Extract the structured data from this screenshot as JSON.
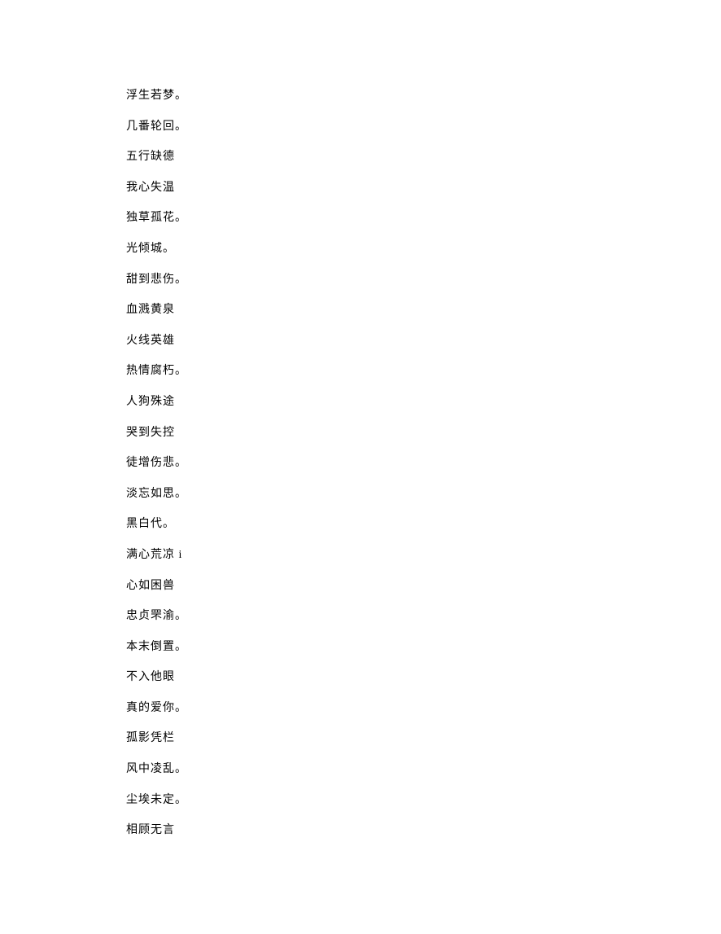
{
  "lines": [
    "浮生若梦。",
    "几番轮回。",
    "五行缺德",
    "我心失温",
    "独草孤花。",
    "光倾城。",
    "甜到悲伤。",
    "血溅黄泉",
    "火线英雄",
    "热情腐朽。",
    "人狗殊途",
    "哭到失控",
    "徒增伤悲。",
    "淡忘如思。",
    "黑白代。",
    "满心荒凉 i",
    "心如困兽",
    "忠贞罘渝。",
    "本末倒置。",
    "不入他眼",
    "真的爱你。",
    "孤影凭栏",
    "风中凌乱。",
    "尘埃未定。",
    "相顾无言"
  ]
}
